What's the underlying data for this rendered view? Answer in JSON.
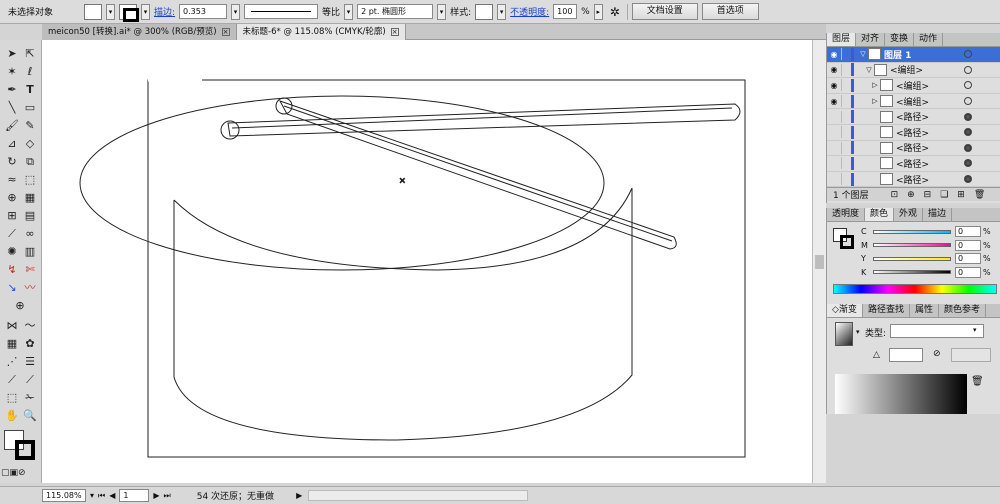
{
  "control_bar": {
    "selection_status": "未选择对象",
    "stroke_label": "描边:",
    "stroke_weight": "0.353",
    "stroke_profile": "等比",
    "brush": "2 pt. 椭圆形",
    "style_label": "样式:",
    "opacity_label": "不透明度:",
    "opacity_value": "100",
    "opacity_unit": "%",
    "doc_setup_button": "文档设置",
    "preferences_button": "首选项"
  },
  "tabs": [
    {
      "label": "meicon50 [转换].ai* @ 300% (RGB/预览)"
    },
    {
      "label": "未标题-6* @ 115.08% (CMYK/轮廓)"
    }
  ],
  "layers_panel": {
    "tabs": [
      "图层",
      "对齐",
      "变换",
      "动作"
    ],
    "rows": [
      {
        "label": "图层 1"
      },
      {
        "label": "<编组>"
      },
      {
        "label": "<编组>"
      },
      {
        "label": "<编组>"
      },
      {
        "label": "<路径>"
      },
      {
        "label": "<路径>"
      },
      {
        "label": "<路径>"
      },
      {
        "label": "<路径>"
      },
      {
        "label": "<路径>"
      }
    ],
    "footer": "1 个图层"
  },
  "color_panel": {
    "tabs": [
      "透明度",
      "颜色",
      "外观",
      "描边"
    ],
    "channels": [
      {
        "name": "C",
        "value": "0",
        "unit": "%"
      },
      {
        "name": "M",
        "value": "0",
        "unit": "%"
      },
      {
        "name": "Y",
        "value": "0",
        "unit": "%"
      },
      {
        "name": "K",
        "value": "0",
        "unit": "%"
      }
    ]
  },
  "gradient_panel": {
    "tabs": [
      "渐变",
      "路径查找",
      "属性",
      "颜色参考"
    ],
    "type_label": "类型:"
  },
  "status_bar": {
    "zoom": "115.08%",
    "artboard": "1",
    "status": "54 次还原；无重做"
  }
}
